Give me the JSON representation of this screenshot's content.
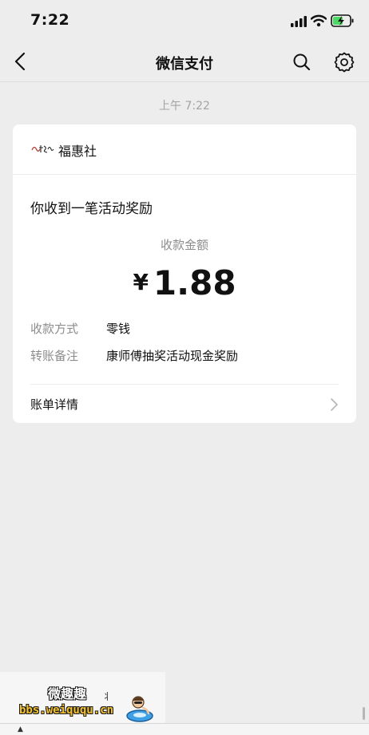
{
  "status_bar": {
    "time": "7:22"
  },
  "nav": {
    "title": "微信支付"
  },
  "chat": {
    "time_label": "上午 7:22"
  },
  "card": {
    "merchant_name": "福惠社",
    "title": "你收到一笔活动奖励",
    "amount_label": "收款金额",
    "currency": "¥",
    "amount": "1.88",
    "rows": [
      {
        "label": "收款方式",
        "value": "零钱"
      },
      {
        "label": "转账备注",
        "value": "康师傅抽奖活动现金奖励"
      }
    ],
    "detail_label": "账单详情"
  },
  "watermark": {
    "title": "微趣趣",
    "url": "bbs.weiququ.cn"
  },
  "icons": [
    "signal-icon",
    "wifi-icon",
    "battery-charging-icon",
    "back-icon",
    "search-icon",
    "gear-icon",
    "chevron-right-icon"
  ],
  "colors": {
    "background": "#ededed",
    "card": "#ffffff",
    "battery_green": "#4cd964",
    "muted_text": "#8c8c8c"
  }
}
